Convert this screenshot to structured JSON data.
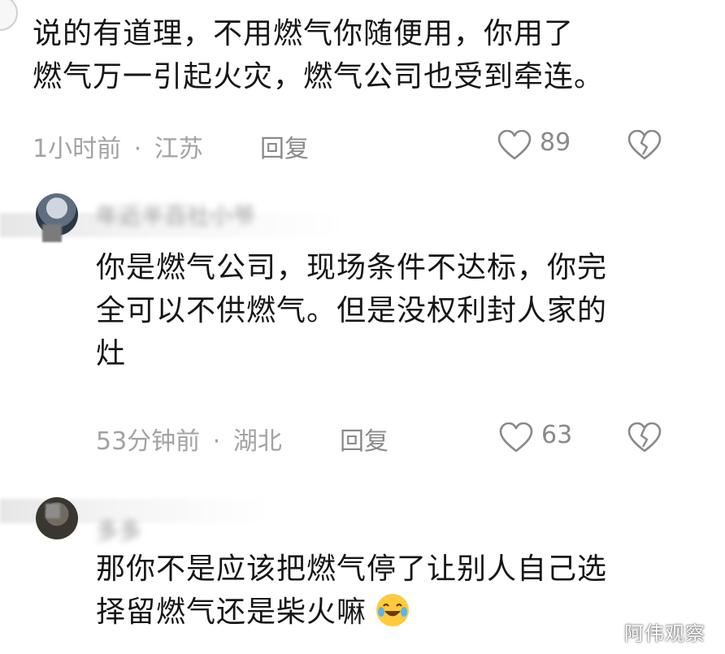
{
  "comments": [
    {
      "text_lines": [
        "说的有道理，不用燃气你随便用，你用了",
        "燃气万一引起火灾，燃气公司也受到牵连。"
      ],
      "time": "1小时前",
      "location": "江苏",
      "reply_label": "回复",
      "likes": "89"
    },
    {
      "author": "年近半百社小爷",
      "text_lines": [
        "你是燃气公司，现场条件不达标，你完",
        "全可以不供燃气。但是没权利封人家的",
        "灶"
      ],
      "time": "53分钟前",
      "location": "湖北",
      "reply_label": "回复",
      "likes": "63"
    },
    {
      "author": "多多",
      "text_lines": [
        "那你不是应该把燃气停了让别人自己选",
        "择留燃气还是柴火嘛"
      ]
    }
  ],
  "separator": "·",
  "watermark": "阿伟观察",
  "icons": {
    "like": "heart-outline-icon",
    "dislike": "broken-heart-icon",
    "emoji": "laughing-tears-emoji"
  },
  "colors": {
    "text": "#161616",
    "meta": "#a3a3a3",
    "icon": "#8a8a8a"
  }
}
